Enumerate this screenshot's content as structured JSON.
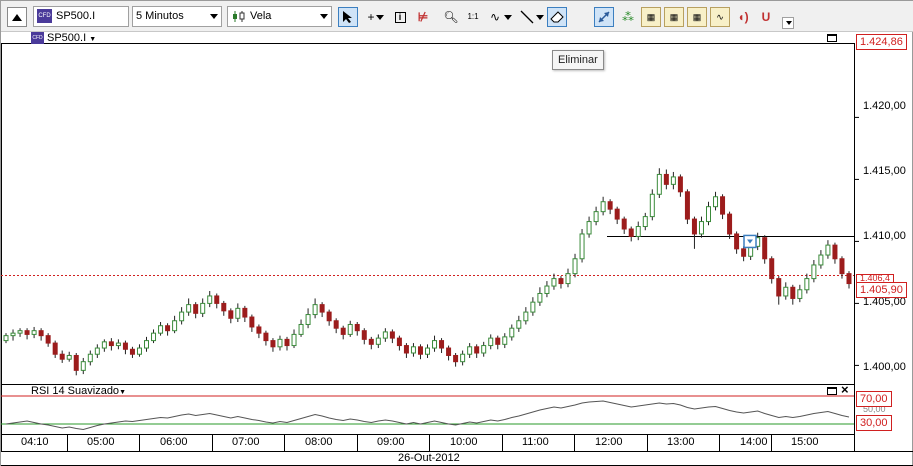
{
  "toolbar": {
    "symbol": "SP500.I",
    "interval": "5 Minutos",
    "chart_style": "Vela",
    "zoom_label": "1:1",
    "symbol_badge": "CFD"
  },
  "tooltip": "Eliminar",
  "main_pane": {
    "symbol_label": "SP500.I",
    "y_ticks": [
      "1.420,00",
      "1.415,00",
      "1.410,00",
      "1.405,00",
      "1.400,00"
    ],
    "last_price": "1.405,90",
    "high_price": "1.424,86",
    "hidden_price": "1.406,4"
  },
  "rsi_pane": {
    "title": "RSI 14 Suavizado",
    "upper_level": "70,00",
    "lower_level": "30,00",
    "mid_level": "50,00"
  },
  "x_axis": {
    "ticks": [
      "04:10",
      "05:00",
      "06:00",
      "07:00",
      "08:00",
      "09:00",
      "10:00",
      "11:00",
      "12:00",
      "13:00",
      "14:00",
      "15:00"
    ],
    "date": "26-Out-2012"
  },
  "colors": {
    "bull": "#3a8a3a",
    "bear": "#9c1c1c",
    "upper": "#d02020",
    "lower": "#2a9a2a",
    "select": "#3c7fc0"
  },
  "chart_data": {
    "type": "candlestick",
    "ylim": [
      1398.5,
      1426
    ],
    "rsi_ylim": [
      0,
      100
    ],
    "resistance_line": 1410.4,
    "candles": [
      [
        1402.0,
        1402.4,
        1402.6,
        1401.8
      ],
      [
        1402.4,
        1402.6,
        1402.9,
        1402.0
      ],
      [
        1402.6,
        1402.8,
        1403.0,
        1402.3
      ],
      [
        1402.8,
        1402.5,
        1403.0,
        1402.1
      ],
      [
        1402.5,
        1402.8,
        1403.1,
        1402.2
      ],
      [
        1402.8,
        1402.4,
        1403.0,
        1402.0
      ],
      [
        1402.4,
        1401.8,
        1402.6,
        1401.5
      ],
      [
        1401.8,
        1400.9,
        1402.0,
        1400.6
      ],
      [
        1400.9,
        1400.5,
        1401.2,
        1400.2
      ],
      [
        1400.5,
        1400.8,
        1401.1,
        1400.3
      ],
      [
        1400.8,
        1399.6,
        1401.0,
        1399.2
      ],
      [
        1399.6,
        1400.3,
        1400.6,
        1399.3
      ],
      [
        1400.3,
        1400.9,
        1401.2,
        1400.0
      ],
      [
        1400.9,
        1401.4,
        1401.7,
        1400.6
      ],
      [
        1401.4,
        1401.9,
        1402.1,
        1401.1
      ],
      [
        1401.9,
        1401.6,
        1402.2,
        1401.2
      ],
      [
        1401.6,
        1401.8,
        1402.1,
        1401.3
      ],
      [
        1401.8,
        1401.3,
        1402.0,
        1400.9
      ],
      [
        1401.3,
        1400.9,
        1401.5,
        1400.6
      ],
      [
        1400.9,
        1401.4,
        1401.7,
        1400.7
      ],
      [
        1401.4,
        1402.0,
        1402.3,
        1401.1
      ],
      [
        1402.0,
        1402.6,
        1402.9,
        1401.8
      ],
      [
        1402.6,
        1403.2,
        1403.5,
        1402.4
      ],
      [
        1403.2,
        1402.8,
        1403.4,
        1402.4
      ],
      [
        1402.8,
        1403.6,
        1404.0,
        1402.6
      ],
      [
        1403.6,
        1404.3,
        1404.7,
        1403.3
      ],
      [
        1404.3,
        1404.9,
        1405.4,
        1404.0
      ],
      [
        1404.9,
        1404.2,
        1405.1,
        1403.8
      ],
      [
        1404.2,
        1405.0,
        1405.4,
        1403.9
      ],
      [
        1405.0,
        1405.6,
        1406.0,
        1404.7
      ],
      [
        1405.6,
        1405.0,
        1405.8,
        1404.6
      ],
      [
        1405.0,
        1404.4,
        1405.2,
        1404.0
      ],
      [
        1404.4,
        1403.8,
        1404.6,
        1403.4
      ],
      [
        1403.8,
        1404.6,
        1405.0,
        1403.5
      ],
      [
        1404.6,
        1403.9,
        1404.8,
        1403.5
      ],
      [
        1403.9,
        1403.1,
        1404.1,
        1402.7
      ],
      [
        1403.1,
        1402.6,
        1403.3,
        1402.2
      ],
      [
        1402.6,
        1402.0,
        1402.8,
        1401.6
      ],
      [
        1402.0,
        1401.5,
        1402.2,
        1401.1
      ],
      [
        1401.5,
        1402.1,
        1402.4,
        1401.2
      ],
      [
        1402.1,
        1401.6,
        1402.3,
        1401.2
      ],
      [
        1401.6,
        1402.5,
        1402.9,
        1401.4
      ],
      [
        1402.5,
        1403.3,
        1403.7,
        1402.3
      ],
      [
        1403.3,
        1404.1,
        1404.6,
        1403.0
      ],
      [
        1404.1,
        1404.9,
        1405.4,
        1403.8
      ],
      [
        1404.9,
        1404.3,
        1405.1,
        1403.9
      ],
      [
        1404.3,
        1403.6,
        1404.5,
        1403.2
      ],
      [
        1403.6,
        1403.0,
        1403.8,
        1402.6
      ],
      [
        1403.0,
        1402.5,
        1403.2,
        1402.1
      ],
      [
        1402.5,
        1403.3,
        1403.6,
        1402.3
      ],
      [
        1403.3,
        1402.8,
        1403.5,
        1402.4
      ],
      [
        1402.8,
        1402.1,
        1403.0,
        1401.7
      ],
      [
        1402.1,
        1401.7,
        1402.3,
        1401.3
      ],
      [
        1401.7,
        1402.2,
        1402.5,
        1401.4
      ],
      [
        1402.2,
        1402.7,
        1403.0,
        1401.9
      ],
      [
        1402.7,
        1402.2,
        1402.9,
        1401.8
      ],
      [
        1402.2,
        1401.6,
        1402.4,
        1401.2
      ],
      [
        1401.6,
        1401.0,
        1401.8,
        1400.6
      ],
      [
        1401.0,
        1401.5,
        1401.8,
        1400.7
      ],
      [
        1401.5,
        1400.9,
        1401.7,
        1400.5
      ],
      [
        1400.9,
        1401.4,
        1401.7,
        1400.6
      ],
      [
        1401.4,
        1402.0,
        1402.4,
        1401.1
      ],
      [
        1402.0,
        1401.4,
        1402.2,
        1401.0
      ],
      [
        1401.4,
        1400.8,
        1401.6,
        1400.4
      ],
      [
        1400.8,
        1400.3,
        1401.0,
        1399.9
      ],
      [
        1400.3,
        1400.9,
        1401.2,
        1400.0
      ],
      [
        1400.9,
        1401.5,
        1401.8,
        1400.6
      ],
      [
        1401.5,
        1401.0,
        1401.7,
        1400.6
      ],
      [
        1401.0,
        1401.6,
        1401.9,
        1400.7
      ],
      [
        1401.6,
        1402.2,
        1402.5,
        1401.3
      ],
      [
        1402.2,
        1401.7,
        1402.4,
        1401.3
      ],
      [
        1401.7,
        1402.3,
        1402.6,
        1401.4
      ],
      [
        1402.3,
        1403.0,
        1403.3,
        1402.0
      ],
      [
        1403.0,
        1403.6,
        1404.0,
        1402.7
      ],
      [
        1403.6,
        1404.3,
        1404.7,
        1403.3
      ],
      [
        1404.3,
        1405.1,
        1405.5,
        1404.0
      ],
      [
        1405.1,
        1405.8,
        1406.3,
        1404.8
      ],
      [
        1405.8,
        1406.4,
        1406.8,
        1405.5
      ],
      [
        1406.4,
        1407.0,
        1407.4,
        1406.1
      ],
      [
        1407.0,
        1406.6,
        1407.2,
        1406.2
      ],
      [
        1406.6,
        1407.4,
        1407.8,
        1406.3
      ],
      [
        1407.4,
        1408.6,
        1409.0,
        1407.1
      ],
      [
        1408.6,
        1410.6,
        1411.0,
        1408.3
      ],
      [
        1410.6,
        1411.6,
        1412.0,
        1410.3
      ],
      [
        1411.6,
        1412.4,
        1412.8,
        1411.3
      ],
      [
        1412.4,
        1413.2,
        1413.6,
        1412.1
      ],
      [
        1413.2,
        1412.6,
        1413.4,
        1412.2
      ],
      [
        1412.6,
        1411.8,
        1412.8,
        1411.4
      ],
      [
        1411.8,
        1411.0,
        1412.0,
        1410.6
      ],
      [
        1411.0,
        1410.4,
        1411.2,
        1410.0
      ],
      [
        1410.4,
        1411.2,
        1411.6,
        1410.1
      ],
      [
        1411.2,
        1412.0,
        1412.3,
        1410.9
      ],
      [
        1412.0,
        1413.8,
        1414.2,
        1411.7
      ],
      [
        1413.8,
        1415.4,
        1415.9,
        1413.5
      ],
      [
        1415.4,
        1414.6,
        1415.8,
        1414.2
      ],
      [
        1414.6,
        1415.2,
        1415.6,
        1414.2
      ],
      [
        1415.2,
        1414.0,
        1415.4,
        1413.6
      ],
      [
        1414.0,
        1411.8,
        1414.2,
        1411.4
      ],
      [
        1411.8,
        1410.6,
        1412.0,
        1409.4
      ],
      [
        1410.6,
        1411.6,
        1412.0,
        1410.3
      ],
      [
        1411.6,
        1412.8,
        1413.2,
        1411.3
      ],
      [
        1412.8,
        1413.6,
        1414.0,
        1412.5
      ],
      [
        1413.6,
        1412.2,
        1413.8,
        1411.8
      ],
      [
        1412.2,
        1410.6,
        1412.4,
        1410.2
      ],
      [
        1410.6,
        1409.4,
        1410.8,
        1409.0
      ],
      [
        1409.4,
        1408.8,
        1409.6,
        1408.4
      ],
      [
        1408.8,
        1409.6,
        1410.0,
        1408.5
      ],
      [
        1409.6,
        1410.3,
        1410.7,
        1409.3
      ],
      [
        1410.3,
        1408.6,
        1410.5,
        1408.2
      ],
      [
        1408.6,
        1407.0,
        1408.8,
        1406.6
      ],
      [
        1407.0,
        1405.6,
        1407.2,
        1404.9
      ],
      [
        1405.6,
        1406.3,
        1406.7,
        1405.3
      ],
      [
        1406.3,
        1405.4,
        1406.5,
        1404.9
      ],
      [
        1405.4,
        1406.1,
        1406.5,
        1405.1
      ],
      [
        1406.1,
        1407.0,
        1407.4,
        1405.8
      ],
      [
        1407.0,
        1408.1,
        1408.5,
        1406.7
      ],
      [
        1408.1,
        1408.9,
        1409.3,
        1407.8
      ],
      [
        1408.9,
        1409.7,
        1410.1,
        1408.6
      ],
      [
        1409.7,
        1408.6,
        1409.9,
        1408.2
      ],
      [
        1408.6,
        1407.4,
        1408.8,
        1407.0
      ],
      [
        1407.4,
        1406.6,
        1407.6,
        1406.2
      ]
    ],
    "rsi": [
      36,
      38,
      40,
      42,
      39,
      36,
      34,
      31,
      28,
      30,
      27,
      25,
      29,
      33,
      36,
      38,
      40,
      42,
      41,
      43,
      45,
      47,
      49,
      48,
      51,
      54,
      56,
      53,
      55,
      57,
      54,
      51,
      48,
      51,
      48,
      45,
      43,
      40,
      38,
      41,
      39,
      43,
      47,
      51,
      55,
      52,
      48,
      45,
      43,
      46,
      44,
      41,
      39,
      42,
      44,
      42,
      39,
      36,
      39,
      36,
      39,
      42,
      39,
      36,
      34,
      37,
      40,
      38,
      41,
      44,
      42,
      45,
      49,
      52,
      56,
      60,
      64,
      67,
      70,
      68,
      71,
      74,
      78,
      80,
      81,
      82,
      79,
      76,
      73,
      70,
      72,
      74,
      76,
      78,
      76,
      77,
      74,
      69,
      66,
      68,
      70,
      71,
      67,
      63,
      60,
      58,
      60,
      62,
      57,
      53,
      49,
      51,
      49,
      51,
      54,
      57,
      59,
      61,
      57,
      53,
      50
    ]
  }
}
